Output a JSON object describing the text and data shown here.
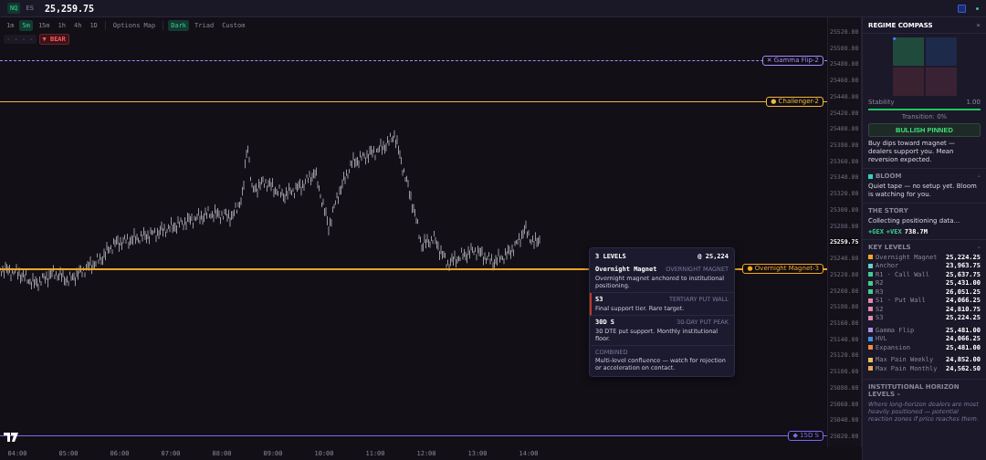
{
  "top_bar": {
    "symbols": [
      {
        "label": "NQ",
        "selected": true
      },
      {
        "label": "ES",
        "selected": false
      }
    ],
    "price": "25,259.75"
  },
  "toolbar": {
    "timeframes": [
      {
        "label": "1m",
        "selected": false
      },
      {
        "label": "5m",
        "selected": true
      },
      {
        "label": "15m",
        "selected": false
      },
      {
        "label": "1h",
        "selected": false
      },
      {
        "label": "4h",
        "selected": false
      },
      {
        "label": "1D",
        "selected": false
      }
    ],
    "options_map": "Options Map",
    "themes": [
      {
        "label": "Dark",
        "selected": true
      },
      {
        "label": "Triad",
        "selected": false
      },
      {
        "label": "Custom",
        "selected": false
      }
    ],
    "legend": "- - - -",
    "bias_badge": "▼ BEAR"
  },
  "chart": {
    "y_ticks": [
      {
        "label": "25520.00",
        "kind": "tick"
      },
      {
        "label": "25500.00",
        "kind": "tick"
      },
      {
        "label": "25480.00",
        "kind": "tick"
      },
      {
        "label": "25460.00",
        "kind": "tick"
      },
      {
        "label": "25440.00",
        "kind": "tick"
      },
      {
        "label": "25420.00",
        "kind": "tick"
      },
      {
        "label": "25400.00",
        "kind": "tick"
      },
      {
        "label": "25380.00",
        "kind": "tick"
      },
      {
        "label": "25360.00",
        "kind": "tick"
      },
      {
        "label": "25340.00",
        "kind": "tick"
      },
      {
        "label": "25320.00",
        "kind": "tick"
      },
      {
        "label": "25300.00",
        "kind": "tick"
      },
      {
        "label": "25280.00",
        "kind": "tick"
      },
      {
        "label": "25259.75",
        "kind": "current"
      },
      {
        "label": "25240.00",
        "kind": "tick"
      },
      {
        "label": "25220.00",
        "kind": "tick"
      },
      {
        "label": "25200.00",
        "kind": "tick"
      },
      {
        "label": "25180.00",
        "kind": "tick"
      },
      {
        "label": "25160.00",
        "kind": "tick"
      },
      {
        "label": "25140.00",
        "kind": "tick"
      },
      {
        "label": "25120.00",
        "kind": "tick"
      },
      {
        "label": "25100.00",
        "kind": "tick"
      },
      {
        "label": "25080.00",
        "kind": "tick"
      },
      {
        "label": "25060.00",
        "kind": "tick"
      },
      {
        "label": "25040.00",
        "kind": "tick"
      },
      {
        "label": "25020.00",
        "kind": "tick"
      }
    ],
    "x_ticks": [
      "04:00",
      "05:00",
      "06:00",
      "07:00",
      "08:00",
      "09:00",
      "10:00",
      "11:00",
      "12:00",
      "13:00",
      "14:00"
    ],
    "level_lines": [
      {
        "label": "✕ Gamma Flip-2",
        "kind": "dashed",
        "color": "#a78bfa"
      },
      {
        "label": "● Challenger-2",
        "kind": "solid",
        "color": "#f5b83d"
      },
      {
        "label": "● Overnight Magnet-3",
        "kind": "thick",
        "color": "#f5a623"
      },
      {
        "label": "◆ 15D S",
        "kind": "solid",
        "color": "#7c6cf0"
      }
    ]
  },
  "tooltip": {
    "title": "3 LEVELS",
    "price": "@ 25,224",
    "entries": [
      {
        "name": "Overnight Magnet",
        "tag": "OVERNIGHT MAGNET",
        "text": "Overnight magnet anchored to institutional positioning.",
        "highlighted": false
      },
      {
        "name": "S3",
        "tag": "TERTIARY PUT WALL",
        "text": "Final support tier. Rare target.",
        "highlighted": true
      },
      {
        "name": "30D S",
        "tag": "30-DAY PUT PEAK",
        "text": "30 DTE put support. Monthly institutional floor.",
        "highlighted": false
      }
    ],
    "combined_label": "COMBINED",
    "combined_text": "Multi-level confluence — watch for rejection or acceleration on contact."
  },
  "panel": {
    "title": "REGIME COMPASS",
    "close": "×",
    "stability_label": "Stability",
    "stability_value": "1.00",
    "stability": {
      "level": 1
    },
    "transition": "Transition: 0%",
    "regime_button": "BULLISH PINNED",
    "regime_text": "Buy dips toward magnet — dealers support you. Mean reversion expected.",
    "bloom": {
      "title": "BLOOM",
      "collapse": "–",
      "text": "Quiet tape — no setup yet. Bloom is watching for you."
    },
    "story": {
      "title": "THE STORY",
      "text": "Collecting positioning data...",
      "gex": "+GEX",
      "vex": "+VEX",
      "value": "738.7M"
    },
    "key_levels": {
      "title": "KEY LEVELS",
      "collapse": "–",
      "groups": [
        [
          {
            "name": "Overnight Magnet",
            "value": "25,224.25",
            "color": "#f5a623"
          },
          {
            "name": "Anchor",
            "value": "23,963.75",
            "color": "#5fd3c4"
          },
          {
            "name": "R1 · Call Wall",
            "value": "25,637.75",
            "color": "#3ecf8e"
          },
          {
            "name": "R2",
            "value": "25,431.00",
            "color": "#3ecf8e"
          },
          {
            "name": "R3",
            "value": "26,051.25",
            "color": "#3ecf8e"
          },
          {
            "name": "S1 · Put Wall",
            "value": "24,066.25",
            "color": "#e08aa8"
          },
          {
            "name": "S2",
            "value": "24,810.75",
            "color": "#e08aa8"
          },
          {
            "name": "S3",
            "value": "25,224.25",
            "color": "#e08aa8"
          }
        ],
        [
          {
            "name": "Gamma Flip",
            "value": "25,481.00",
            "color": "#b48ee0"
          },
          {
            "name": "HVL",
            "value": "24,066.25",
            "color": "#4a90e2"
          },
          {
            "name": "Expansion",
            "value": "25,481.00",
            "color": "#f08c3a"
          }
        ],
        [
          {
            "name": "Max Pain Weekly",
            "value": "24,852.00",
            "color": "#e8c25a"
          },
          {
            "name": "Max Pain Monthly",
            "value": "24,562.50",
            "color": "#e8a75a"
          }
        ]
      ]
    },
    "institutional": {
      "title": "INSTITUTIONAL HORIZON LEVELS –",
      "text": "Where long-horizon dealers are most heavily positioned — potential reaction zones if price reaches them."
    }
  }
}
